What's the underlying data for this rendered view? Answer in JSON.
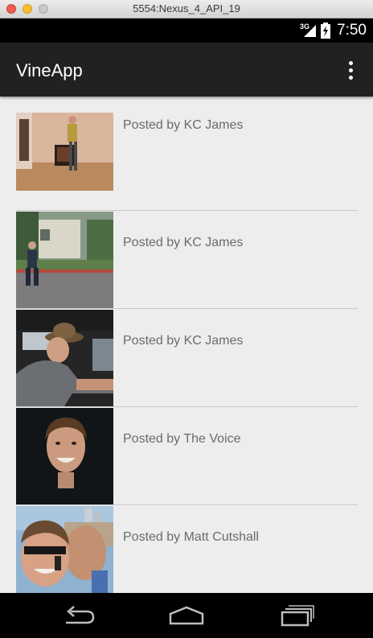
{
  "window": {
    "title": "5554:Nexus_4_API_19"
  },
  "status_bar": {
    "network": "3G",
    "time": "7:50"
  },
  "app_bar": {
    "title": "VineApp",
    "overflow_icon": "more-vert-icon"
  },
  "feed": {
    "items": [
      {
        "poster": "Posted by KC James"
      },
      {
        "poster": "Posted by KC James"
      },
      {
        "poster": "Posted by KC James"
      },
      {
        "poster": "Posted by The Voice"
      },
      {
        "poster": "Posted by Matt Cutshall"
      }
    ]
  },
  "nav_bar": {
    "icons": [
      "back-icon",
      "home-icon",
      "recent-apps-icon"
    ]
  }
}
